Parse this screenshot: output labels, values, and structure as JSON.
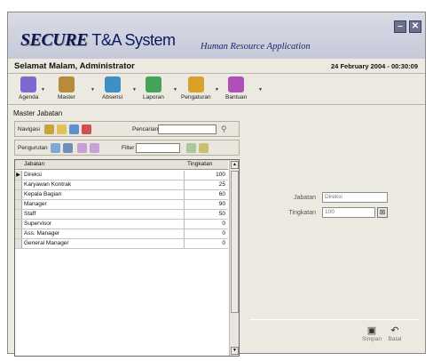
{
  "header": {
    "logo_main": "SECURE",
    "logo_suffix": "T&A System",
    "tagline": "Human Resource Application",
    "minimize_glyph": "–",
    "close_glyph": "✕"
  },
  "status": {
    "greeting": "Selamat Malam, Administrator",
    "datetime": "24 February 2004 - 00:30:09"
  },
  "toolbar": {
    "items": [
      {
        "label": "Agenda",
        "icon": "agenda-icon",
        "color": "#7d6ad0"
      },
      {
        "label": "Master",
        "icon": "master-icon",
        "color": "#b88a3c"
      },
      {
        "label": "Absensi",
        "icon": "absensi-icon",
        "color": "#3f8fc7"
      },
      {
        "label": "Laporan",
        "icon": "laporan-icon",
        "color": "#46a35a"
      },
      {
        "label": "Pengaturan",
        "icon": "pengaturan-icon",
        "color": "#d8a12a"
      },
      {
        "label": "Bantuan",
        "icon": "bantuan-icon",
        "color": "#b04fb8"
      }
    ],
    "arrow": "▼"
  },
  "panel": {
    "title": "Master Jabatan",
    "navigasi_label": "Navigasi",
    "pencarian_label": "Pencarian",
    "pengurutan_label": "Pengurutan",
    "filter_label": "Filter"
  },
  "grid": {
    "columns": [
      "Jabatan",
      "Tingkatan"
    ],
    "current_marker": "▶",
    "rows": [
      {
        "jabatan": "Direksi",
        "tingkatan": "100"
      },
      {
        "jabatan": "Karyawan Kontrak",
        "tingkatan": "25"
      },
      {
        "jabatan": "Kepala Bagian",
        "tingkatan": "60"
      },
      {
        "jabatan": "Manager",
        "tingkatan": "90"
      },
      {
        "jabatan": "Staff",
        "tingkatan": "50"
      },
      {
        "jabatan": "Supervisor",
        "tingkatan": "0"
      },
      {
        "jabatan": "Ass. Manager",
        "tingkatan": "0"
      },
      {
        "jabatan": "General Manager",
        "tingkatan": "0"
      }
    ]
  },
  "form": {
    "jabatan_label": "Jabatan",
    "jabatan_value": "Direksi",
    "tingkatan_label": "Tingkatan",
    "tingkatan_value": "100"
  },
  "actions": {
    "simpan": "Simpan",
    "batal": "Batal"
  }
}
